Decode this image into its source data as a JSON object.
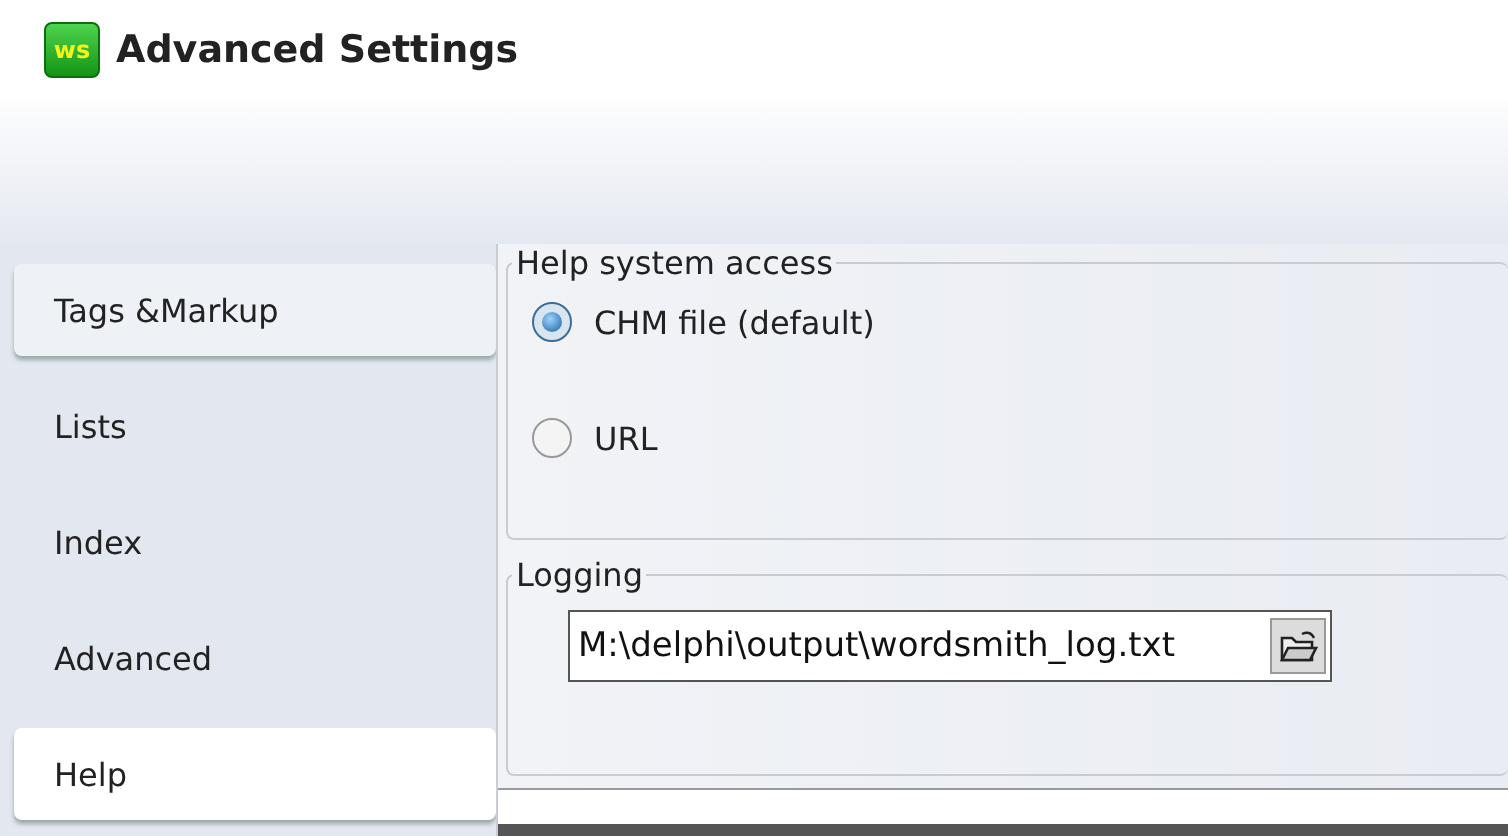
{
  "window": {
    "title": "Advanced Settings",
    "logo": "ws"
  },
  "tabs": [
    {
      "label": "Tags &Markup",
      "selected": false,
      "highlighted": true
    },
    {
      "label": "Lists",
      "selected": false,
      "highlighted": false
    },
    {
      "label": "Index",
      "selected": false,
      "highlighted": false
    },
    {
      "label": "Advanced",
      "selected": false,
      "highlighted": false
    },
    {
      "label": "Help",
      "selected": true,
      "highlighted": false
    }
  ],
  "help_access": {
    "title": "Help system access",
    "options": [
      {
        "label": "CHM file (default)",
        "selected": true
      },
      {
        "label": "URL",
        "selected": false
      }
    ]
  },
  "logging": {
    "title": "Logging",
    "value": "M:\\delphi\\output\\wordsmith_log.txt"
  }
}
